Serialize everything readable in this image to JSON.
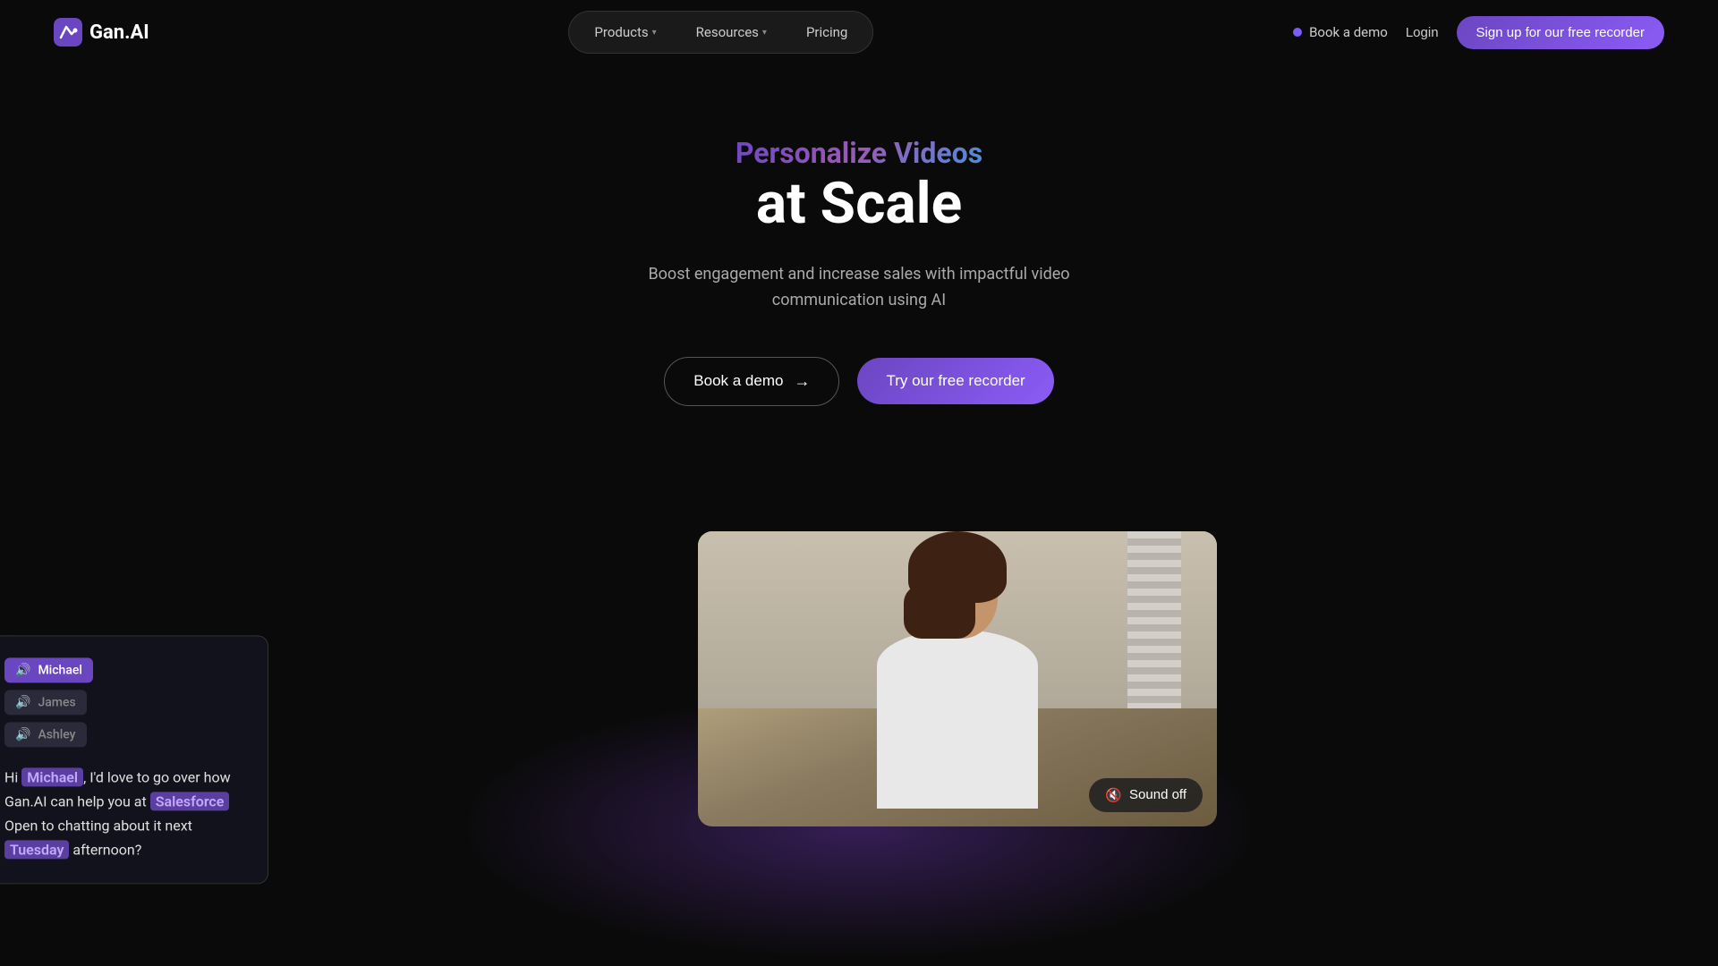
{
  "nav": {
    "logo_text": "Gan.AI",
    "items": [
      {
        "label": "Products",
        "has_dropdown": true
      },
      {
        "label": "Resources",
        "has_dropdown": true
      },
      {
        "label": "Pricing",
        "has_dropdown": false
      }
    ],
    "book_demo": "Book a demo",
    "login": "Login",
    "signup": "Sign up for our free recorder"
  },
  "hero": {
    "title_line1": "Personalize Videos",
    "title_line2": "at Scale",
    "subtitle_line1": "Boost engagement and increase sales with impactful video",
    "subtitle_line2": "communication using AI",
    "btn_book_demo": "Book a demo",
    "btn_try_recorder": "Try our free recorder"
  },
  "video": {
    "sound_off_label": "Sound off"
  },
  "personalization_card": {
    "tabs": [
      {
        "label": "Michael",
        "active": true
      },
      {
        "label": "James",
        "active": false
      },
      {
        "label": "Ashley",
        "active": false
      }
    ],
    "text_before_name": "Hi ",
    "name": "Michael",
    "text_after_name": ", I'd love to go over how Gan.AI can help you at ",
    "company": "Salesforce",
    "text_after_company": " Open to chatting about it next ",
    "day": "Tuesday",
    "text_end": " afternoon?"
  }
}
